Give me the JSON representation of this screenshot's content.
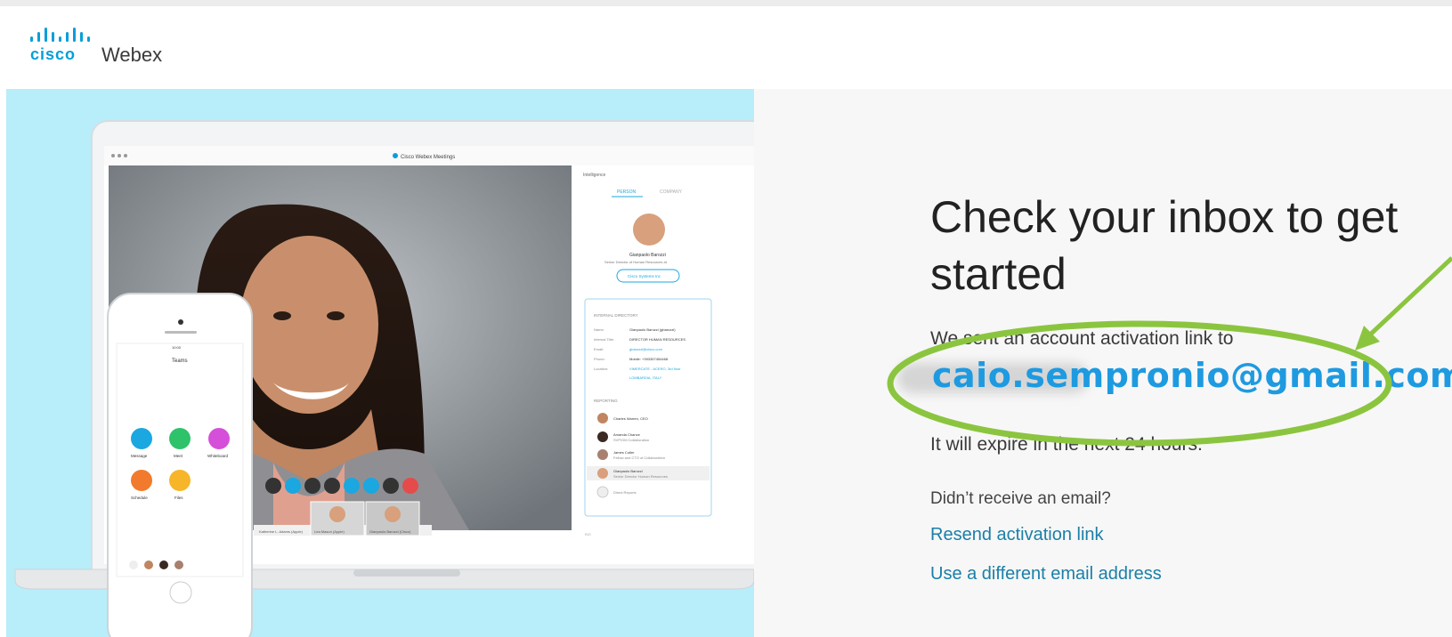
{
  "brand": {
    "company": "cisco",
    "product": "Webex",
    "color": "#049fd9"
  },
  "main": {
    "headline": "Check your inbox to get started",
    "sent_text": "We sent an account activation link to",
    "email": "caio.sempronio@gmail.com",
    "expire_text": "It will expire in the next 24 hours.",
    "didnt_receive": "Didn’t receive an email?",
    "resend_link": "Resend activation link",
    "different_email_link": "Use a different email address",
    "link_color": "#1a7fa8",
    "email_color": "#1e9ae0"
  },
  "annotation": {
    "ellipse_color": "#8bc53f",
    "arrow_color": "#8bc53f"
  },
  "hero": {
    "background": "#b7eefa",
    "laptop_window_title": "Cisco Webex Meetings",
    "panel_title": "Intelligence",
    "tabs": [
      "PERSON",
      "COMPANY"
    ],
    "contact_name": "Gianpaolo Barozzi",
    "contact_role": "Senior Director of Human Resources at",
    "company_button": "Cisco Systems Inc",
    "directory_heading": "INTERNAL DIRECTORY",
    "directory_rows": [
      {
        "label": "Name:",
        "value": "Gianpaolo Barozzi (gbarozzi)"
      },
      {
        "label": "Internal Title:",
        "value": "DIRECTOR HUMAN RESOURCES"
      },
      {
        "label": "Email:",
        "value": "gbarozzi@cisco.com"
      },
      {
        "label": "Phone:",
        "value": "Mobile: +393357454468"
      },
      {
        "label": "Location:",
        "value": "VIMERCATE - ACERO, 3rd floor"
      },
      {
        "label": "",
        "value": "LOMBARDIA, ITALY"
      }
    ],
    "reporting_heading": "REPORTING",
    "reporting": [
      {
        "name": "Charles Warren, CEO",
        "title": ""
      },
      {
        "name": "Amanda Chance",
        "title": "SVP/GM Collaboration"
      },
      {
        "name": "James Cutler",
        "title": "Fellow and CTO of Collaboration"
      },
      {
        "name": "Gianpaolo Barozzi",
        "title": "Senior Director Human Resources"
      },
      {
        "name": "Direct Reports",
        "title": ""
      }
    ],
    "phone_title": "Teams",
    "phone_time": "10:00",
    "phone_apps": [
      {
        "label": "Message",
        "color": "#1ba7e0"
      },
      {
        "label": "Meet",
        "color": "#2ec26b"
      },
      {
        "label": "Whiteboard",
        "color": "#d64fd8"
      },
      {
        "label": "Schedule",
        "color": "#f27a2c"
      },
      {
        "label": "Files",
        "color": "#f7b52a"
      }
    ],
    "participants": [
      "Katherine L. Adams (Apple)",
      "Lea Mason (Apple)",
      "Gianpaolo Barozzi (Cisco)"
    ],
    "bio_label": "BIO"
  }
}
